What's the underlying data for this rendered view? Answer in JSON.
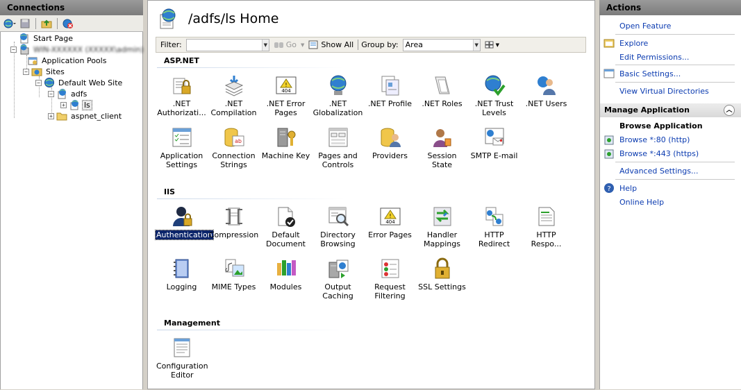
{
  "left_panel": {
    "title": "Connections",
    "toolbar": [
      "globe-connect-icon",
      "save-icon",
      "up-folder-icon",
      "disconnect-icon"
    ],
    "tree": {
      "start_page": "Start Page",
      "server": "WIN-XXXXXX (XXXXX\\admin)",
      "app_pools": "Application Pools",
      "sites": "Sites",
      "default_site": "Default Web Site",
      "adfs": "adfs",
      "ls": "ls",
      "aspnet_client": "aspnet_client"
    }
  },
  "center": {
    "title": "/adfs/ls Home",
    "filter_bar": {
      "filter_label": "Filter:",
      "go_label": "Go",
      "show_all_label": "Show All",
      "group_by_label": "Group by:",
      "group_by_value": "Area"
    },
    "sections": {
      "aspnet": "ASP.NET",
      "iis": "IIS",
      "management": "Management"
    },
    "features": {
      "net_auth": ".NET Authorizati...",
      "net_compilation": ".NET Compilation",
      "net_error_pages": ".NET Error Pages",
      "net_globalization": ".NET Globalization",
      "net_profile": ".NET Profile",
      "net_roles": ".NET Roles",
      "net_trust": ".NET Trust Levels",
      "net_users": ".NET Users",
      "app_settings": "Application Settings",
      "conn_strings": "Connection Strings",
      "machine_key": "Machine Key",
      "pages_controls": "Pages and Controls",
      "providers": "Providers",
      "session_state": "Session State",
      "smtp": "SMTP E-mail",
      "authentication": "Authentication",
      "compression": "Compression",
      "default_doc": "Default Document",
      "dir_browsing": "Directory Browsing",
      "error_pages": "Error Pages",
      "handler_mappings": "Handler Mappings",
      "http_redirect": "HTTP Redirect",
      "http_response": "HTTP Respo...",
      "logging": "Logging",
      "mime_types": "MIME Types",
      "modules": "Modules",
      "output_caching": "Output Caching",
      "request_filtering": "Request Filtering",
      "ssl_settings": "SSL Settings",
      "config_editor": "Configuration Editor"
    }
  },
  "right_panel": {
    "title": "Actions",
    "open_feature": "Open Feature",
    "explore": "Explore",
    "edit_permissions": "Edit Permissions...",
    "basic_settings": "Basic Settings...",
    "view_virtual_dirs": "View Virtual Directories",
    "manage_app": "Manage Application",
    "browse_app": "Browse Application",
    "browse_80": "Browse *:80 (http)",
    "browse_443": "Browse *:443 (https)",
    "advanced_settings": "Advanced Settings...",
    "help": "Help",
    "online_help": "Online Help"
  },
  "colors": {
    "link": "#0b3bb0",
    "selection": "#0a246a",
    "header": "#8a8a8a"
  }
}
